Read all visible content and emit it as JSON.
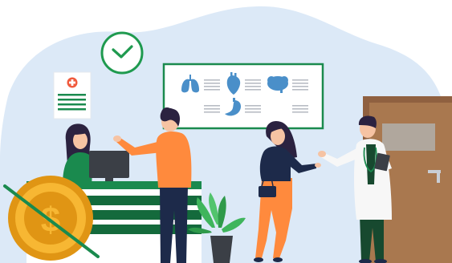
{
  "scene": {
    "subject": "clinic-reception",
    "colors": {
      "background_blob": "#dce9f7",
      "brand_green": "#1a8a4e",
      "green_dark": "#146a3c",
      "clock_green": "#1f9a4f",
      "skin": "#f6c3a3",
      "hair": "#2b2240",
      "orange_shirt": "#ff8a3d",
      "navy": "#1d2a4a",
      "door_brown": "#a9784f",
      "door_frame": "#8f6040",
      "door_window": "#b0a79d",
      "white": "#ffffff",
      "organ_blue": "#4a8fc9",
      "gold": "#f7b733",
      "gold_dark": "#e09514",
      "monitor": "#3b3f46",
      "doc_coat": "#f7f7f7",
      "doc_pants": "#17492f"
    },
    "icons": [
      "clock-icon",
      "medical-cross-icon",
      "lungs-icon",
      "heart-icon",
      "brain-icon",
      "stomach-icon",
      "dollar-coin-icon",
      "plant-icon",
      "clipboard-icon"
    ]
  }
}
